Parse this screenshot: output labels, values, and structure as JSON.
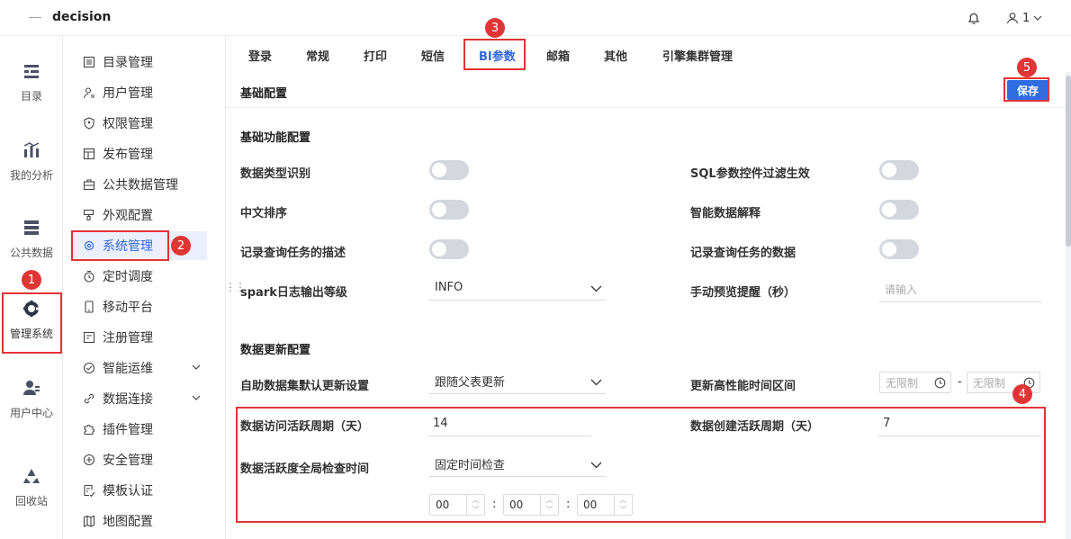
{
  "app": {
    "logo": "decision",
    "user_label": "1"
  },
  "nav_primary": [
    {
      "label": "目录",
      "icon": "catalog-icon"
    },
    {
      "label": "我的分析",
      "icon": "analysis-icon"
    },
    {
      "label": "公共数据",
      "icon": "public-data-icon"
    },
    {
      "label": "管理系统",
      "icon": "admin-gear-icon",
      "active": true
    },
    {
      "label": "用户中心",
      "icon": "user-center-icon"
    },
    {
      "label": "回收站",
      "icon": "recycle-icon"
    }
  ],
  "nav_secondary": [
    {
      "label": "目录管理"
    },
    {
      "label": "用户管理"
    },
    {
      "label": "权限管理"
    },
    {
      "label": "发布管理"
    },
    {
      "label": "公共数据管理"
    },
    {
      "label": "外观配置"
    },
    {
      "label": "系统管理",
      "active": true
    },
    {
      "label": "定时调度"
    },
    {
      "label": "移动平台"
    },
    {
      "label": "注册管理"
    },
    {
      "label": "智能运维",
      "expandable": true
    },
    {
      "label": "数据连接",
      "expandable": true
    },
    {
      "label": "插件管理"
    },
    {
      "label": "安全管理"
    },
    {
      "label": "模板认证"
    },
    {
      "label": "地图配置"
    }
  ],
  "tabs": [
    {
      "label": "登录"
    },
    {
      "label": "常规"
    },
    {
      "label": "打印"
    },
    {
      "label": "短信"
    },
    {
      "label": "BI参数",
      "active": true
    },
    {
      "label": "邮箱"
    },
    {
      "label": "其他"
    },
    {
      "label": "引擎集群管理"
    }
  ],
  "panel": {
    "title": "基础配置",
    "save_label": "保存"
  },
  "basic": {
    "title": "基础功能配置",
    "data_type_recognition": {
      "label": "数据类型识别",
      "on": false
    },
    "sql_filter": {
      "label": "SQL参数控件过滤生效",
      "on": false
    },
    "chinese_sort": {
      "label": "中文排序",
      "on": false
    },
    "smart_explain": {
      "label": "智能数据解释",
      "on": false
    },
    "log_query_desc": {
      "label": "记录查询任务的描述",
      "on": false
    },
    "log_query_data": {
      "label": "记录查询任务的数据",
      "on": false
    },
    "spark_log": {
      "label": "spark日志输出等级",
      "value": "INFO"
    },
    "manual_preview": {
      "label": "手动预览提醒（秒）",
      "placeholder": "请输入"
    }
  },
  "update": {
    "title": "数据更新配置",
    "default_update": {
      "label": "自助数据集默认更新设置",
      "value": "跟随父表更新"
    },
    "perf_window": {
      "label": "更新高性能时间区间",
      "start": "无限制",
      "sep": "-",
      "end": "无限制"
    },
    "visit_period": {
      "label": "数据访问活跃周期（天）",
      "value": "14"
    },
    "create_period": {
      "label": "数据创建活跃周期（天）",
      "value": "7"
    },
    "global_check": {
      "label": "数据活跃度全局检查时间",
      "value": "固定时间检查"
    },
    "time": {
      "hour": "00",
      "minute": "00",
      "second": "00",
      "sep": ":"
    }
  },
  "annotations": [
    "1",
    "2",
    "3",
    "4",
    "5"
  ],
  "colors": {
    "accent": "#3366dd",
    "annotation": "#e03535",
    "save": "#2f6be3"
  }
}
